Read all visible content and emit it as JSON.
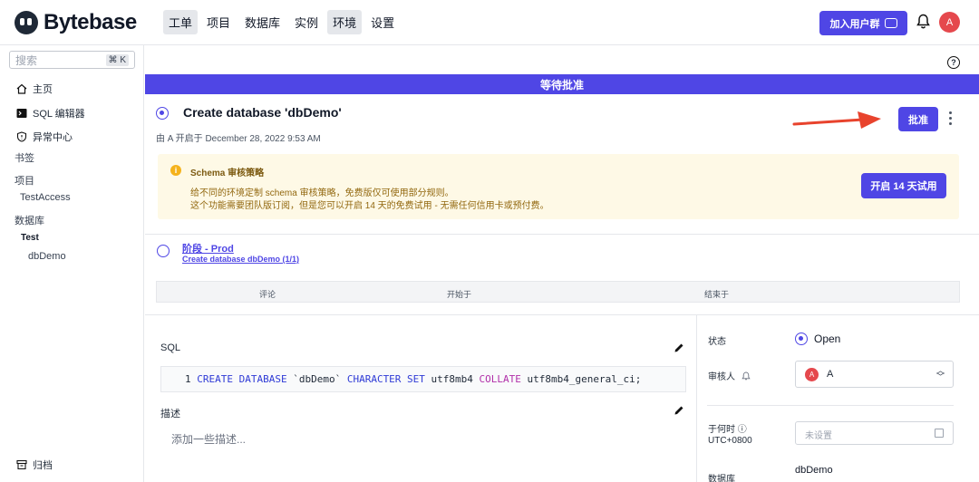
{
  "app": {
    "brand": "Bytebase"
  },
  "nav": {
    "items": [
      {
        "label": "工单",
        "active": true
      },
      {
        "label": "项目",
        "active": false
      },
      {
        "label": "数据库",
        "active": false
      },
      {
        "label": "实例",
        "active": false
      },
      {
        "label": "环境",
        "active": true
      },
      {
        "label": "设置",
        "active": false
      }
    ],
    "join_label": "加入用户群",
    "user_initial": "A"
  },
  "sidebar": {
    "search_placeholder": "搜索",
    "search_shortcut": "⌘ K",
    "home": "主页",
    "sql_editor": "SQL 编辑器",
    "anomaly": "异常中心",
    "bookmarks": "书签",
    "projects": "项目",
    "project_item": "TestAccess",
    "databases": "数据库",
    "env": "Test",
    "db_item": "dbDemo",
    "archive": "归档"
  },
  "banner": {
    "text": "等待批准"
  },
  "issue": {
    "title": "Create database 'dbDemo'",
    "meta": "由 A 开启于 December 28, 2022 9:53 AM",
    "approve_label": "批准"
  },
  "notice": {
    "title": "Schema 审核策略",
    "line1": "给不同的环境定制 schema 审核策略，免费版仅可使用部分规则。",
    "line2": "这个功能需要团队版订阅，但是您可以开启 14 天的免费试用 - 无需任何信用卡或预付费。",
    "trial_label": "开启 14 天试用"
  },
  "stage": {
    "title": "阶段 - Prod",
    "subtitle": "Create database dbDemo (1/1)"
  },
  "table": {
    "headers": [
      "评论",
      "开始于",
      "结束于"
    ]
  },
  "sql": {
    "label": "SQL",
    "line_no": "1",
    "kw1": "CREATE DATABASE",
    "name": " `dbDemo` ",
    "kw2": "CHARACTER SET",
    "charset": " utf8mb4 ",
    "kw3": "COLLATE",
    "collate": " utf8mb4_general_ci;"
  },
  "description": {
    "label": "描述",
    "placeholder": "添加一些描述..."
  },
  "panel": {
    "status_label": "状态",
    "status_value": "Open",
    "reviewer_label": "审核人",
    "reviewer_initial": "A",
    "reviewer_name": "A",
    "when_label": "于何时 ⓘ",
    "timezone": "UTC+0800",
    "when_placeholder": "未设置",
    "database_label": "数据库",
    "database_value": "dbDemo"
  },
  "colors": {
    "accent": "#4f46e5",
    "avatar": "#e5484d",
    "notice_bg": "#fef9e6",
    "arrow": "#e8432d"
  }
}
